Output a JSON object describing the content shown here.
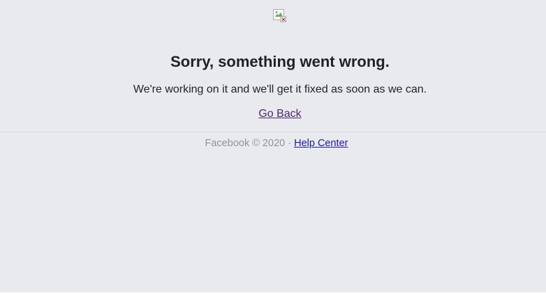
{
  "error": {
    "image_icon": "broken-image-icon",
    "title": "Sorry, something went wrong.",
    "message": "We're working on it and we'll get it fixed as soon as we can.",
    "go_back_label": "Go Back"
  },
  "footer": {
    "copyright": "Facebook © 2020",
    "separator": "·",
    "help_center_label": "Help Center"
  },
  "colors": {
    "background": "#e9eaed",
    "text": "#1d2129",
    "muted_text": "#8d949e",
    "visited_link": "#4b2a6b",
    "link": "#1a1aa6"
  }
}
